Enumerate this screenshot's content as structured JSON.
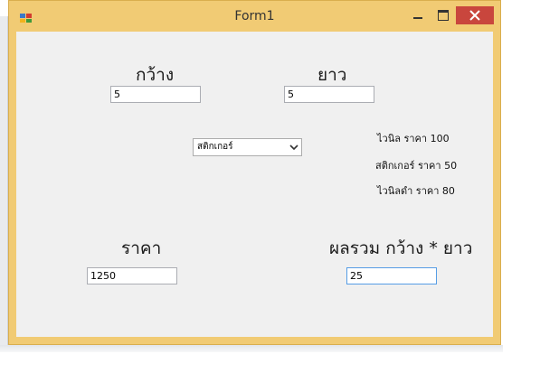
{
  "window": {
    "title": "Form1"
  },
  "labels": {
    "width": "กว้าง",
    "length": "ยาว",
    "price": "ราคา",
    "total": "ผลรวม กว้าง * ยาว",
    "price_vinyl": "ไวนิล ราคา 100",
    "price_sticker": "สติกเกอร์ ราคา 50",
    "price_vinyl_black": "ไวนิลดำ ราคา 80"
  },
  "inputs": {
    "width_value": "5",
    "length_value": "5",
    "price_value": "1250",
    "total_value": "25"
  },
  "combo": {
    "selected": "สติกเกอร์"
  },
  "colors": {
    "frame": "#f1cb74",
    "close_button": "#c9463d",
    "client_bg": "#f0f0f0",
    "focus_border": "#569de5"
  },
  "icons": {
    "app": "windows-form-icon",
    "minimize": "minimize-icon",
    "maximize": "maximize-icon",
    "close": "close-icon",
    "dropdown": "chevron-down-icon"
  }
}
